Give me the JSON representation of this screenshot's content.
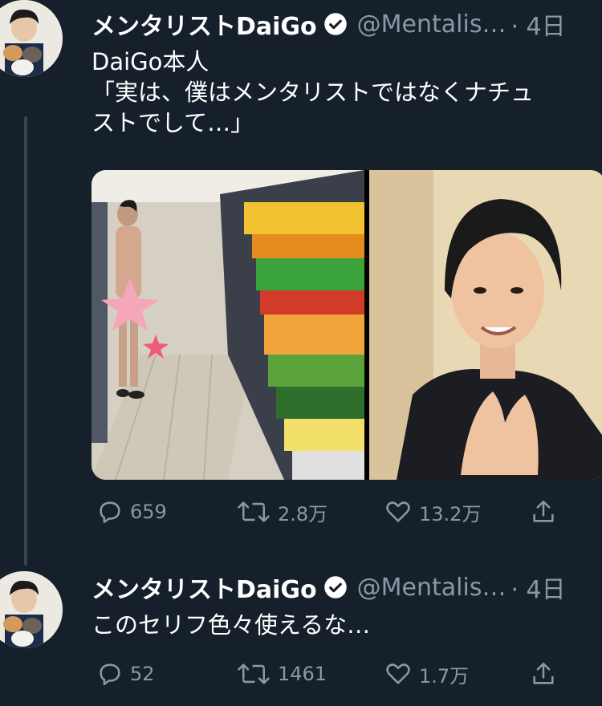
{
  "tweets": [
    {
      "name": "メンタリストDaiGo",
      "handle": "@Mentalis…",
      "time": "· 4日",
      "text": "DaiGo本人\n「実は、僕はメンタリストではなくナチュ\nストでして…」",
      "replies": "659",
      "retweets": "2.8万",
      "likes": "13.2万"
    },
    {
      "name": "メンタリストDaiGo",
      "handle": "@Mentalis…",
      "time": "· 4日",
      "text": "このセリフ色々使えるな…",
      "replies": "52",
      "retweets": "1461",
      "likes": "1.7万"
    }
  ],
  "icons": {
    "verified": "verified-badge-icon",
    "reply": "reply-icon",
    "retweet": "retweet-icon",
    "like": "heart-icon",
    "share": "share-icon"
  },
  "colors": {
    "background": "#15202b",
    "secondary_text": "#8899a6",
    "thread_line": "#38444d"
  }
}
